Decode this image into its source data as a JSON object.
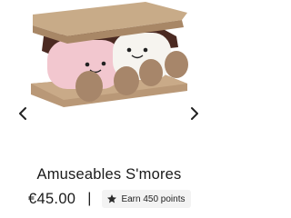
{
  "product": {
    "title": "Amuseables S'mores",
    "price": "€45.00",
    "separator": "|",
    "points_label": "Earn 450 points"
  },
  "icons": {
    "prev": "chevron-left-icon",
    "next": "chevron-right-icon",
    "points": "star-icon"
  },
  "colors": {
    "text": "#1a1a1a",
    "badge_bg": "#f3f3f3"
  }
}
